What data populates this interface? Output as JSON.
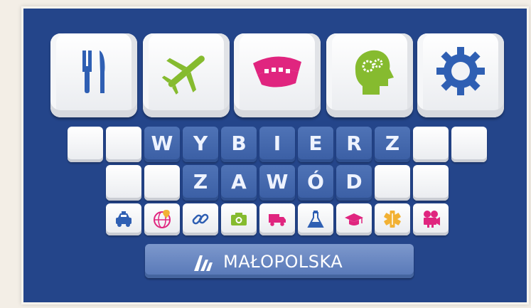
{
  "heading_letters": [
    "W",
    "Y",
    "B",
    "I",
    "E",
    "R",
    "Z"
  ],
  "subheading_letters": [
    "Z",
    "A",
    "W",
    "Ó",
    "D"
  ],
  "brand": "MAŁOPOLSKA",
  "top_icons": [
    "fork-knife-icon",
    "airplane-icon",
    "dental-jaw-icon",
    "head-gears-icon",
    "gear-icon"
  ],
  "small_icons": [
    "car-icon",
    "globe-pin-icon",
    "link-icon",
    "camera-icon",
    "truck-icon",
    "flask-icon",
    "graduation-cap-icon",
    "medical-star-icon",
    "film-camera-icon"
  ],
  "colors": {
    "background_blue": "#24458a",
    "letter_key_blue": "#4a6db1",
    "icon_blue": "#2f5fb3",
    "icon_green": "#86bb2f",
    "icon_pink": "#e0257f",
    "icon_yellow": "#f2b134"
  }
}
